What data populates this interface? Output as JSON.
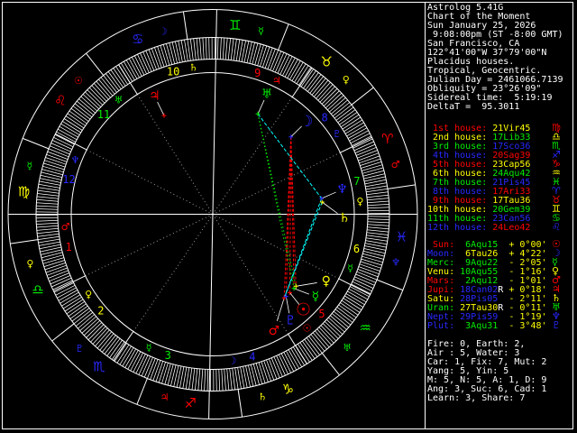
{
  "colors": {
    "red": "#ff0000",
    "yellow": "#ffff00",
    "green": "#00ee00",
    "blue": "#2828ff",
    "cyan": "#00ffff",
    "white": "#ffffff",
    "gray": "#989898",
    "black": "#000000"
  },
  "element_colors": {
    "fire": "#ff0000",
    "earth": "#ffff00",
    "air": "#00ee00",
    "water": "#2828ff"
  },
  "element_of_sign": {
    "Ari": "fire",
    "Tau": "earth",
    "Gem": "air",
    "Can": "water",
    "Leo": "fire",
    "Vir": "earth",
    "Lib": "air",
    "Sco": "water",
    "Sag": "fire",
    "Cap": "earth",
    "Aqu": "air",
    "Pis": "water"
  },
  "sign_order": [
    "Ari",
    "Tau",
    "Gem",
    "Can",
    "Leo",
    "Vir",
    "Lib",
    "Sco",
    "Sag",
    "Cap",
    "Aqu",
    "Pis"
  ],
  "sign_glyphs": {
    "Ari": "♈",
    "Tau": "♉",
    "Gem": "♊",
    "Can": "♋",
    "Leo": "♌",
    "Vir": "♍",
    "Lib": "♎",
    "Sco": "♏",
    "Sag": "♐",
    "Cap": "♑",
    "Aqu": "♒",
    "Pis": "♓"
  },
  "planet_glyphs": {
    "sun": "☉",
    "moon": "☽",
    "merc": "☿",
    "venus": "♀",
    "mars": "♂",
    "jup": "♃",
    "sat": "♄",
    "uran": "♅",
    "nept": "♆",
    "plut": "♇"
  },
  "planet_colors": {
    "sun": "#ff0000",
    "moon": "#2828ff",
    "merc": "#00ee00",
    "venus": "#ffff00",
    "mars": "#ff0000",
    "jup": "#ff0000",
    "sat": "#ffff00",
    "uran": "#00ee00",
    "nept": "#2828ff",
    "plut": "#2828ff"
  },
  "sign_rulers": {
    "Ari": "mars",
    "Tau": "venus",
    "Gem": "merc",
    "Can": "moon",
    "Leo": "sun",
    "Vir": "merc",
    "Lib": "venus",
    "Sco": "plut",
    "Sag": "jup",
    "Cap": "sat",
    "Aqu": "uran",
    "Pis": "nept"
  },
  "house_rulers": [
    "mars",
    "venus",
    "merc",
    "moon",
    "sun",
    "merc",
    "venus",
    "plut",
    "jup",
    "sat",
    "uran",
    "nept"
  ],
  "house_color_cycle": [
    "fire",
    "earth",
    "air",
    "water"
  ],
  "panel": {
    "header_lines": [
      "Astrolog 5.41G",
      "Chart of the Moment",
      "Sun January 25, 2026",
      " 9:08:00pm (ST -8:00 GMT)",
      "San Francisco, CA",
      "122°41'00\"W 37°79'00\"N",
      "Placidus houses.",
      "Tropical, Geocentric.",
      "Julian Day = 2461066.7139",
      "Obliquity = 23°26'09\"",
      "Sidereal time:  5:19:19",
      "DeltaT =  95.3011"
    ],
    "houses": [
      {
        "label": " 1st house:",
        "value": "21Vir45",
        "sign": "Vir"
      },
      {
        "label": " 2nd house:",
        "value": "17Lib33",
        "sign": "Lib"
      },
      {
        "label": " 3rd house:",
        "value": "17Sco36",
        "sign": "Sco"
      },
      {
        "label": " 4th house:",
        "value": "20Sag39",
        "sign": "Sag"
      },
      {
        "label": " 5th house:",
        "value": "23Cap56",
        "sign": "Cap"
      },
      {
        "label": " 6th house:",
        "value": "24Aqu42",
        "sign": "Aqu"
      },
      {
        "label": " 7th house:",
        "value": "21Pis45",
        "sign": "Pis"
      },
      {
        "label": " 8th house:",
        "value": "17Ari33",
        "sign": "Ari"
      },
      {
        "label": " 9th house:",
        "value": "17Tau36",
        "sign": "Tau"
      },
      {
        "label": "10th house:",
        "value": "20Gem39",
        "sign": "Gem"
      },
      {
        "label": "11th house:",
        "value": "23Can56",
        "sign": "Can"
      },
      {
        "label": "12th house:",
        "value": "24Leo42",
        "sign": "Leo"
      }
    ],
    "planets": [
      {
        "name": " Sun:",
        "value": " 6Aqu15",
        "retro": " ",
        "offset": "+ 0°00'",
        "sign": "Aqu",
        "id": "sun"
      },
      {
        "name": "Moon:",
        "value": " 6Tau26",
        "retro": " ",
        "offset": "+ 4°22'",
        "sign": "Tau",
        "id": "moon"
      },
      {
        "name": "Merc:",
        "value": " 9Aqu22",
        "retro": " ",
        "offset": "- 2°05'",
        "sign": "Aqu",
        "id": "merc"
      },
      {
        "name": "Venu:",
        "value": "10Aqu55",
        "retro": " ",
        "offset": "- 1°16'",
        "sign": "Aqu",
        "id": "venus"
      },
      {
        "name": "Mars:",
        "value": " 2Aqu12",
        "retro": " ",
        "offset": "- 1°01'",
        "sign": "Aqu",
        "id": "mars"
      },
      {
        "name": "Jupi:",
        "value": "18Can02",
        "retro": "R",
        "offset": "+ 0°18'",
        "sign": "Can",
        "id": "jup"
      },
      {
        "name": "Satu:",
        "value": "28Pis05",
        "retro": " ",
        "offset": "- 2°11'",
        "sign": "Pis",
        "id": "sat"
      },
      {
        "name": "Uran:",
        "value": "27Tau30",
        "retro": "R",
        "offset": "- 0°11'",
        "sign": "Tau",
        "id": "uran"
      },
      {
        "name": "Nept:",
        "value": "29Pis59",
        "retro": " ",
        "offset": "- 1°19'",
        "sign": "Pis",
        "id": "nept"
      },
      {
        "name": "Plut:",
        "value": " 3Aqu31",
        "retro": " ",
        "offset": "- 3°48'",
        "sign": "Aqu",
        "id": "plut"
      }
    ],
    "stats": [
      "Fire: 0, Earth: 2,",
      "Air : 5, Water: 3",
      "Car: 1, Fix: 7, Mut: 2",
      "Yang: 5, Yin: 5",
      "M: 5, N: 5, A: 1, D: 9",
      "Ang: 3, Suc: 6, Cad: 1",
      "Learn: 3, Share: 7"
    ]
  },
  "wheel": {
    "asc_lon": 171.75,
    "house_cusps_lon": [
      171.75,
      197.55,
      227.6,
      260.65,
      293.93,
      324.7,
      351.75,
      17.55,
      47.6,
      80.65,
      113.93,
      144.7
    ],
    "planets": [
      {
        "id": "sun",
        "lon": 306.25,
        "display_lon": 305.25
      },
      {
        "id": "moon",
        "lon": 36.43,
        "display_lon": 36.43
      },
      {
        "id": "merc",
        "lon": 309.37,
        "display_lon": 313.05
      },
      {
        "id": "venus",
        "lon": 310.92,
        "display_lon": 321.15
      },
      {
        "id": "mars",
        "lon": 302.2,
        "display_lon": 289.45
      },
      {
        "id": "jup",
        "lon": 108.03,
        "display_lon": 108.03
      },
      {
        "id": "sat",
        "lon": 358.08,
        "display_lon": 349.95
      },
      {
        "id": "uran",
        "lon": 57.5,
        "display_lon": 57.5
      },
      {
        "id": "nept",
        "lon": 359.98,
        "display_lon": 2.55
      },
      {
        "id": "plut",
        "lon": 303.52,
        "display_lon": 297.95
      }
    ],
    "aspects": [
      {
        "a": "moon",
        "b": "sun",
        "color": "#ff0000",
        "dash": "3,2"
      },
      {
        "a": "moon",
        "b": "merc",
        "color": "#ff0000",
        "dash": "3,2"
      },
      {
        "a": "moon",
        "b": "venus",
        "color": "#ff0000",
        "dash": "3,2"
      },
      {
        "a": "moon",
        "b": "mars",
        "color": "#ff0000",
        "dash": "3,2"
      },
      {
        "a": "moon",
        "b": "plut",
        "color": "#ff0000",
        "dash": "3,2"
      },
      {
        "a": "uran",
        "b": "nept",
        "color": "#00ffff",
        "dash": "4,2"
      },
      {
        "a": "nept",
        "b": "mars",
        "color": "#00ffff",
        "dash": "4,2"
      },
      {
        "a": "sat",
        "b": "mars",
        "color": "#00ffff",
        "dash": "4,2"
      },
      {
        "a": "uran",
        "b": "merc",
        "color": "#00ee00",
        "dash": "1.5,2.5"
      },
      {
        "a": "uran",
        "b": "venus",
        "color": "#00ee00",
        "dash": "1.5,2.5"
      }
    ]
  }
}
